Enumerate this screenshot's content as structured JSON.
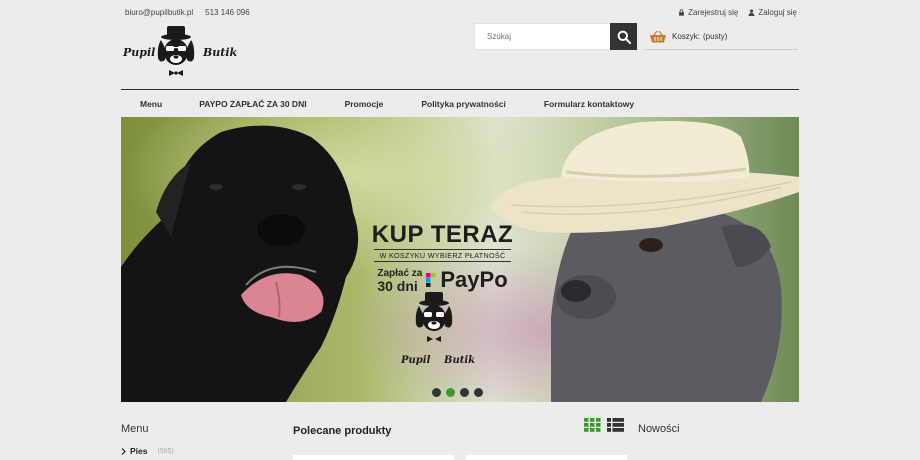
{
  "topbar": {
    "email": "biuro@pupilbutik.pl",
    "phone": "513 146 096",
    "register": "Zarejestruj się",
    "login": "Zaloguj się"
  },
  "logo": {
    "text_left": "Pupil",
    "text_right": "Butik"
  },
  "search": {
    "placeholder": "Szukaj"
  },
  "cart": {
    "label": "Koszyk:",
    "status": "(pusty)"
  },
  "nav": [
    "Menu",
    "PAYPO ZAPŁAĆ ZA 30 DNI",
    "Promocje",
    "Polityka prywatności",
    "Formularz kontaktowy"
  ],
  "banner": {
    "headline": "KUP TERAZ",
    "subline": "W KOSZYKU WYBIERZ PŁATNOŚĆ",
    "pay_small_1": "Zapłać za",
    "pay_small_2": "30 dni",
    "pay_brand": "PayPo",
    "logo_text_left": "Pupil",
    "logo_text_right": "Butik",
    "active_slide": 2,
    "slide_count": 4
  },
  "sidebar": {
    "title": "Menu",
    "items": [
      {
        "label": "Pies",
        "count": "(585)"
      }
    ]
  },
  "featured": {
    "title": "Polecane produkty"
  },
  "new_products": {
    "title": "Nowości"
  },
  "colors": {
    "accent": "#3b9a2c",
    "dark": "#333333",
    "paypo_pink": "#e6007e",
    "paypo_green": "#a3c61e"
  }
}
